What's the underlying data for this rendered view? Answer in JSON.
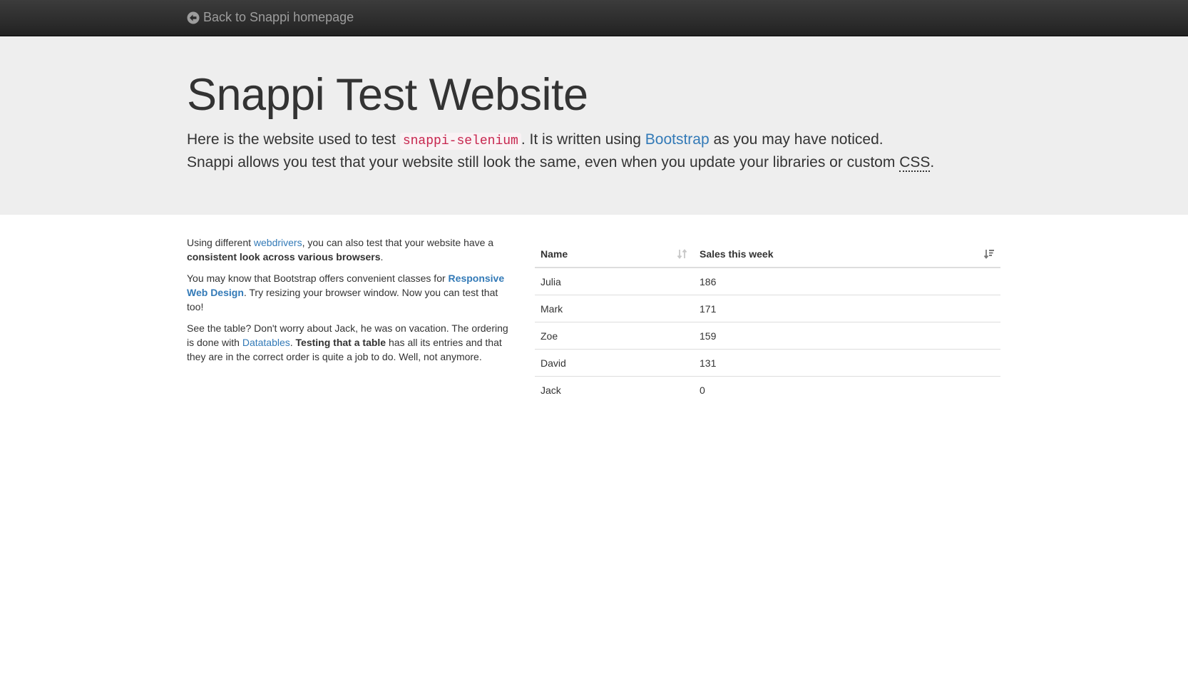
{
  "navbar": {
    "back_link": "Back to Snappi homepage",
    "icon": "arrow-circle-left-icon"
  },
  "jumbotron": {
    "title": "Snappi Test Website",
    "line1_prefix": "Here is the website used to test ",
    "line1_code": "snappi-selenium",
    "line1_mid": ". It is written using ",
    "line1_link": "Bootstrap",
    "line1_suffix": " as you may have noticed.",
    "line2_prefix": "Snappi allows you test that your website still look the same, even when you update your libraries or custom ",
    "line2_abbr": "CSS",
    "line2_suffix": "."
  },
  "content": {
    "p1_prefix": "Using different ",
    "p1_link": "webdrivers",
    "p1_mid": ", you can also test that your website have a ",
    "p1_bold": "consistent look across various browsers",
    "p1_suffix": ".",
    "p2_prefix": "You may know that Bootstrap offers convenient classes for ",
    "p2_link": "Responsive Web Design",
    "p2_suffix": ". Try resizing your browser window. Now you can test that too!",
    "p3_prefix": "See the table? Don't worry about Jack, he was on vacation. The ordering is done with ",
    "p3_link": "Datatables",
    "p3_mid": ". ",
    "p3_bold": "Testing that a table",
    "p3_suffix": " has all its entries and that they are in the correct order is quite a job to do. Well, not anymore."
  },
  "table": {
    "headers": [
      "Name",
      "Sales this week"
    ],
    "header_icons": [
      "sort-both-icon",
      "sort-desc-icon"
    ],
    "rows": [
      [
        "Julia",
        "186"
      ],
      [
        "Mark",
        "171"
      ],
      [
        "Zoe",
        "159"
      ],
      [
        "David",
        "131"
      ],
      [
        "Jack",
        "0"
      ]
    ]
  },
  "colors": {
    "link": "#337ab7",
    "code": "#c7254e",
    "navbar": "#222222",
    "jumbotron": "#eeeeee"
  }
}
